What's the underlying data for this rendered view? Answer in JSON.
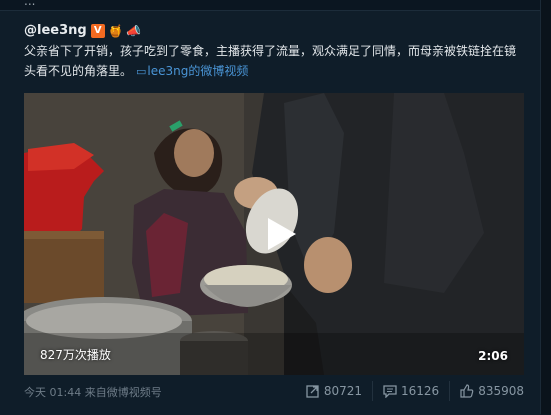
{
  "top_cut_text": "...",
  "post": {
    "username": "@lee3ng",
    "badges": [
      "v-badge",
      "fan-badge",
      "horn-badge"
    ],
    "text": "父亲省下了开销，孩子吃到了零食，主播获得了流量，观众满足了同情，而母亲被铁链拴在镜头看不见的角落里。",
    "link_icon": "video-link-icon",
    "link_text": "lee3ng的微博视频"
  },
  "video": {
    "views": "827万次播放",
    "duration": "2:06"
  },
  "footer": {
    "time": "今天 01:44",
    "source": "来自微博视频号",
    "repost_count": "80721",
    "comment_count": "16126",
    "like_count": "835908"
  },
  "colors": {
    "background": "#0f1d29",
    "link": "#4a95d6",
    "muted": "#6e7c88"
  }
}
